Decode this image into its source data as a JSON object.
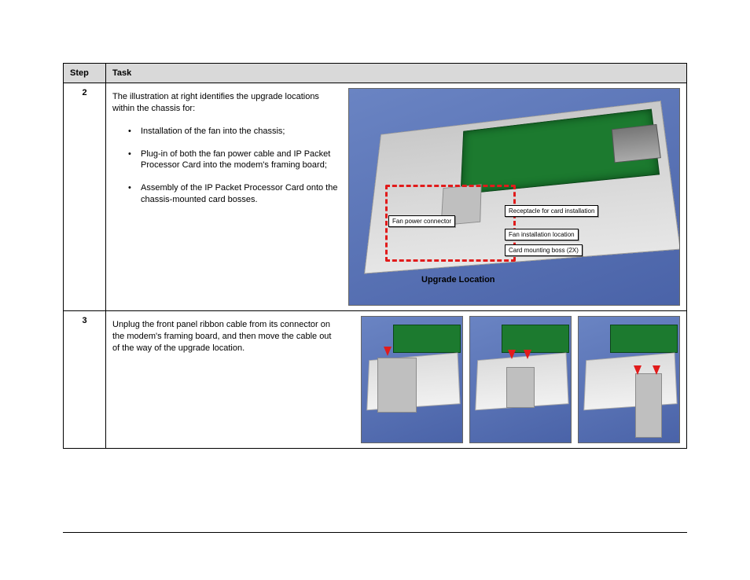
{
  "table": {
    "headers": {
      "step": "Step",
      "task": "Task"
    },
    "rows": [
      {
        "step": "2",
        "intro": "The illustration at right identifies the upgrade locations within the chassis for:",
        "bullets": [
          "Installation of the fan into the chassis;",
          "Plug-in of both the fan power cable and IP Packet Processor Card into the modem's framing board;",
          "Assembly of the IP Packet Processor Card onto the chassis-mounted card bosses."
        ],
        "figure": {
          "callouts": {
            "fan_power": "Fan power connector",
            "receptacle": "Receptacle for card installation",
            "fan_location": "Fan installation location",
            "boss": "Card mounting boss (2X)"
          },
          "upgrade_label": "Upgrade Location"
        }
      },
      {
        "step": "3",
        "intro": "Unplug the front panel ribbon cable from its connector on the modem's framing board, and then move the cable out of the way of the upgrade location."
      }
    ]
  }
}
